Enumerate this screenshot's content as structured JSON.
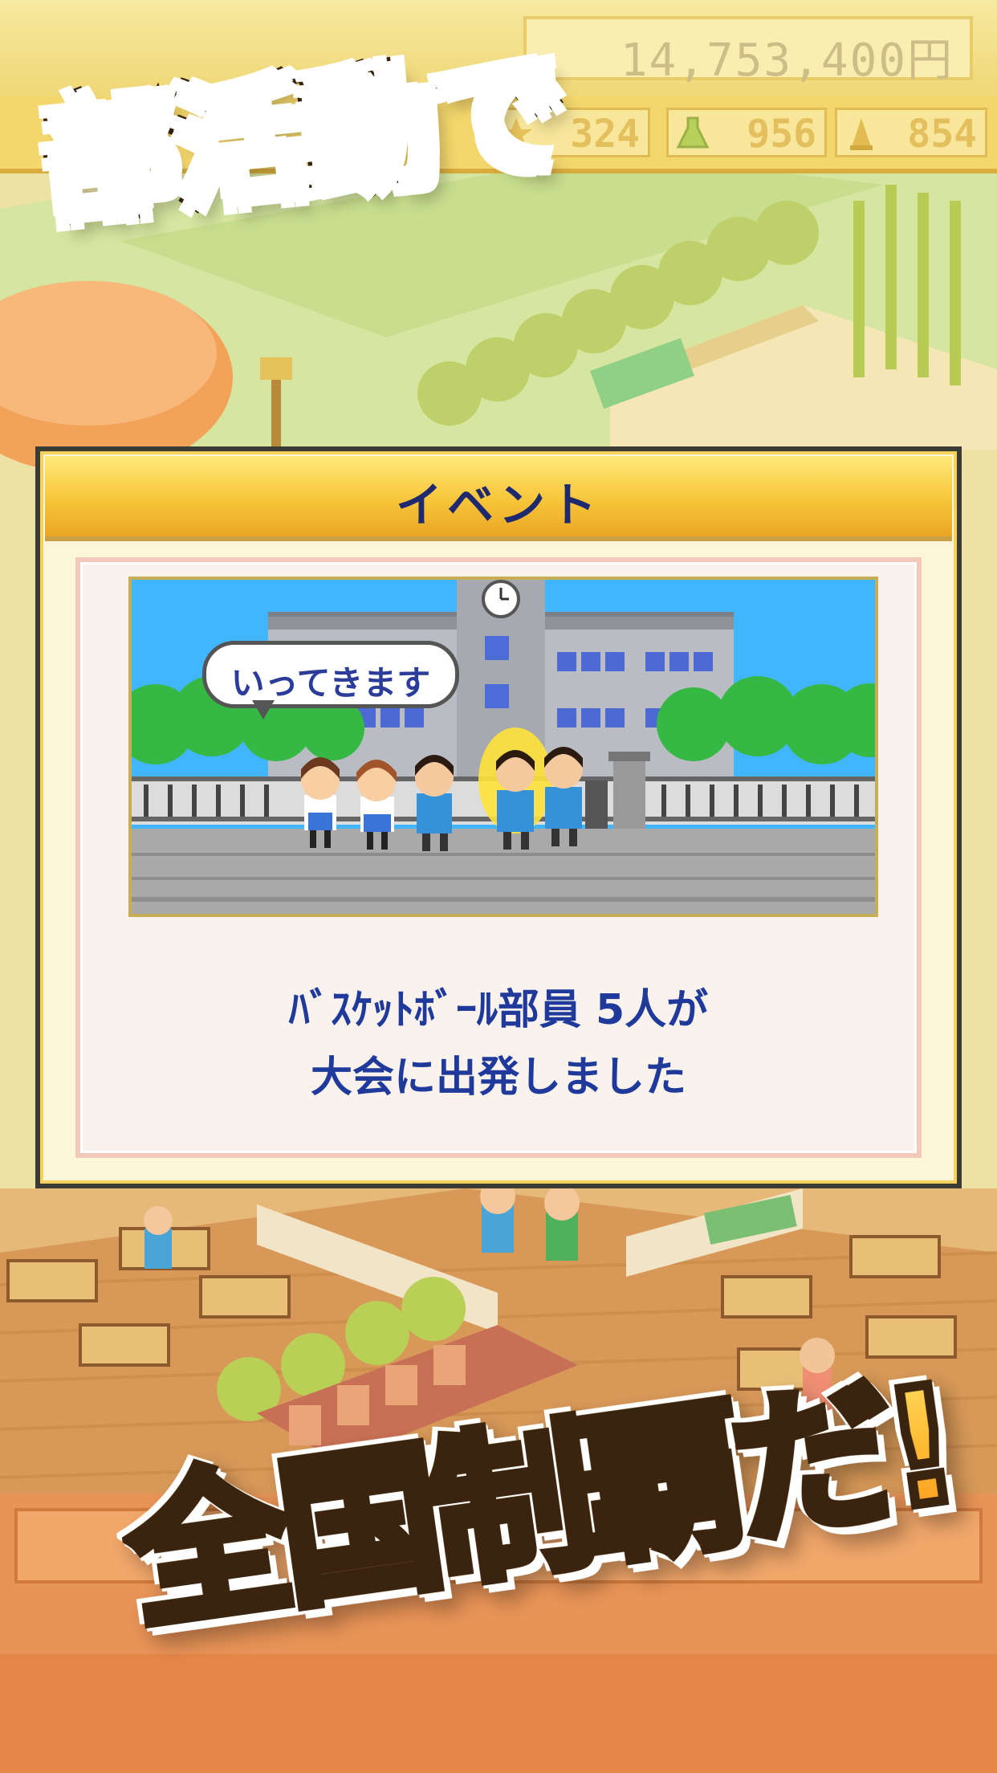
{
  "hud": {
    "money": "14,753,400円",
    "stats": [
      {
        "icon": "star-icon",
        "value": "324"
      },
      {
        "icon": "flask-icon",
        "value": "956"
      },
      {
        "icon": "trophy-icon",
        "value": "854"
      }
    ]
  },
  "headline": {
    "top": "部活動で",
    "bottom": "全国制覇だ!"
  },
  "event_dialog": {
    "title": "イベント",
    "speech": "いってきます",
    "message_line1": "ﾊﾞｽｹｯﾄﾎﾞｰﾙ部員 5人が",
    "message_line2": "大会に出発しました"
  },
  "colors": {
    "header_gold": "#f7c53a",
    "title_navy": "#1f2a6e",
    "message_blue": "#1f3a9a",
    "headline_green": "#8ae45a",
    "headline_orange": "#ffb72e"
  }
}
